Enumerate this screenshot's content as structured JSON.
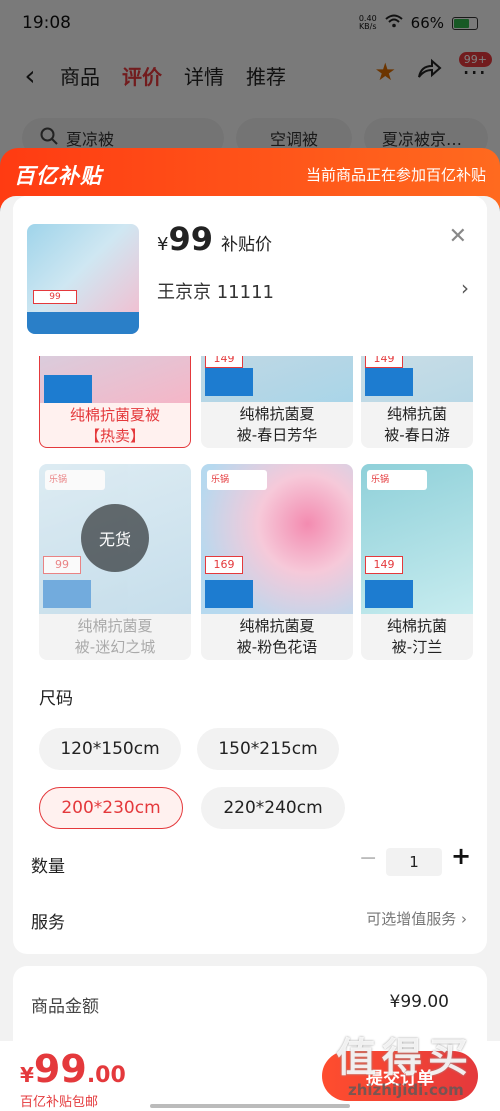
{
  "status_bar": {
    "time": "19:08",
    "net_speed_top": "0.40",
    "net_speed_bottom": "KB/s",
    "battery": "66%"
  },
  "top_nav": {
    "back_icon": "chevron-left-icon",
    "tabs": [
      "商品",
      "评价",
      "详情",
      "推荐"
    ],
    "active_tab": "评价",
    "cart_badge": "99+"
  },
  "search_row": {
    "search_text": "夏凉被",
    "chips": [
      "空调被",
      "夏凉被京…"
    ]
  },
  "subsidy_banner": {
    "logo": "百亿补贴",
    "message": "当前商品正在参加百亿补贴"
  },
  "product": {
    "currency": "¥",
    "price": "99",
    "price_label": "补贴价",
    "seller": "王京京  11111",
    "thumb_tag": "99"
  },
  "variants": [
    {
      "name": "纯棉抗菌夏被【热卖】",
      "line1": "纯棉抗菌夏被",
      "line2": "【热卖】",
      "selected": true,
      "out_of_stock": false,
      "price_tag": ""
    },
    {
      "name": "纯棉抗菌夏被-春日芳华",
      "line1": "纯棉抗菌夏",
      "line2": "被-春日芳华",
      "selected": false,
      "out_of_stock": false,
      "price_tag": "149"
    },
    {
      "name": "纯棉抗菌夏被-春日游",
      "line1": "纯棉抗菌",
      "line2": "被-春日游",
      "selected": false,
      "out_of_stock": false,
      "price_tag": "149"
    },
    {
      "name": "纯棉抗菌夏被-迷幻之城",
      "line1": "纯棉抗菌夏",
      "line2": "被-迷幻之城",
      "selected": false,
      "out_of_stock": true,
      "price_tag": "99"
    },
    {
      "name": "纯棉抗菌夏被-粉色花语",
      "line1": "纯棉抗菌夏",
      "line2": "被-粉色花语",
      "selected": false,
      "out_of_stock": false,
      "price_tag": "169"
    },
    {
      "name": "纯棉抗菌夏被-汀兰",
      "line1": "纯棉抗菌",
      "line2": "被-汀兰",
      "selected": false,
      "out_of_stock": false,
      "price_tag": "149"
    }
  ],
  "out_of_stock_label": "无货",
  "size_section": {
    "label": "尺码",
    "options": [
      "120*150cm",
      "150*215cm",
      "200*230cm",
      "220*240cm"
    ],
    "selected": "200*230cm"
  },
  "quantity": {
    "label": "数量",
    "value": "1",
    "minus": "−",
    "plus": "+"
  },
  "service": {
    "label": "服务",
    "value": "可选增值服务",
    "arrow": "›"
  },
  "amount": {
    "label": "商品金额",
    "value": "¥99.00"
  },
  "bottom_bar": {
    "currency": "¥",
    "price_int": "99",
    "price_dec": ".00",
    "sub": "百亿补贴包邮",
    "submit": "提交订单"
  },
  "watermark": {
    "text": "值得买",
    "domain": "zhizhijidi.com"
  },
  "colors": {
    "accent": "#e4393c",
    "banner": "#ff4a1a"
  }
}
